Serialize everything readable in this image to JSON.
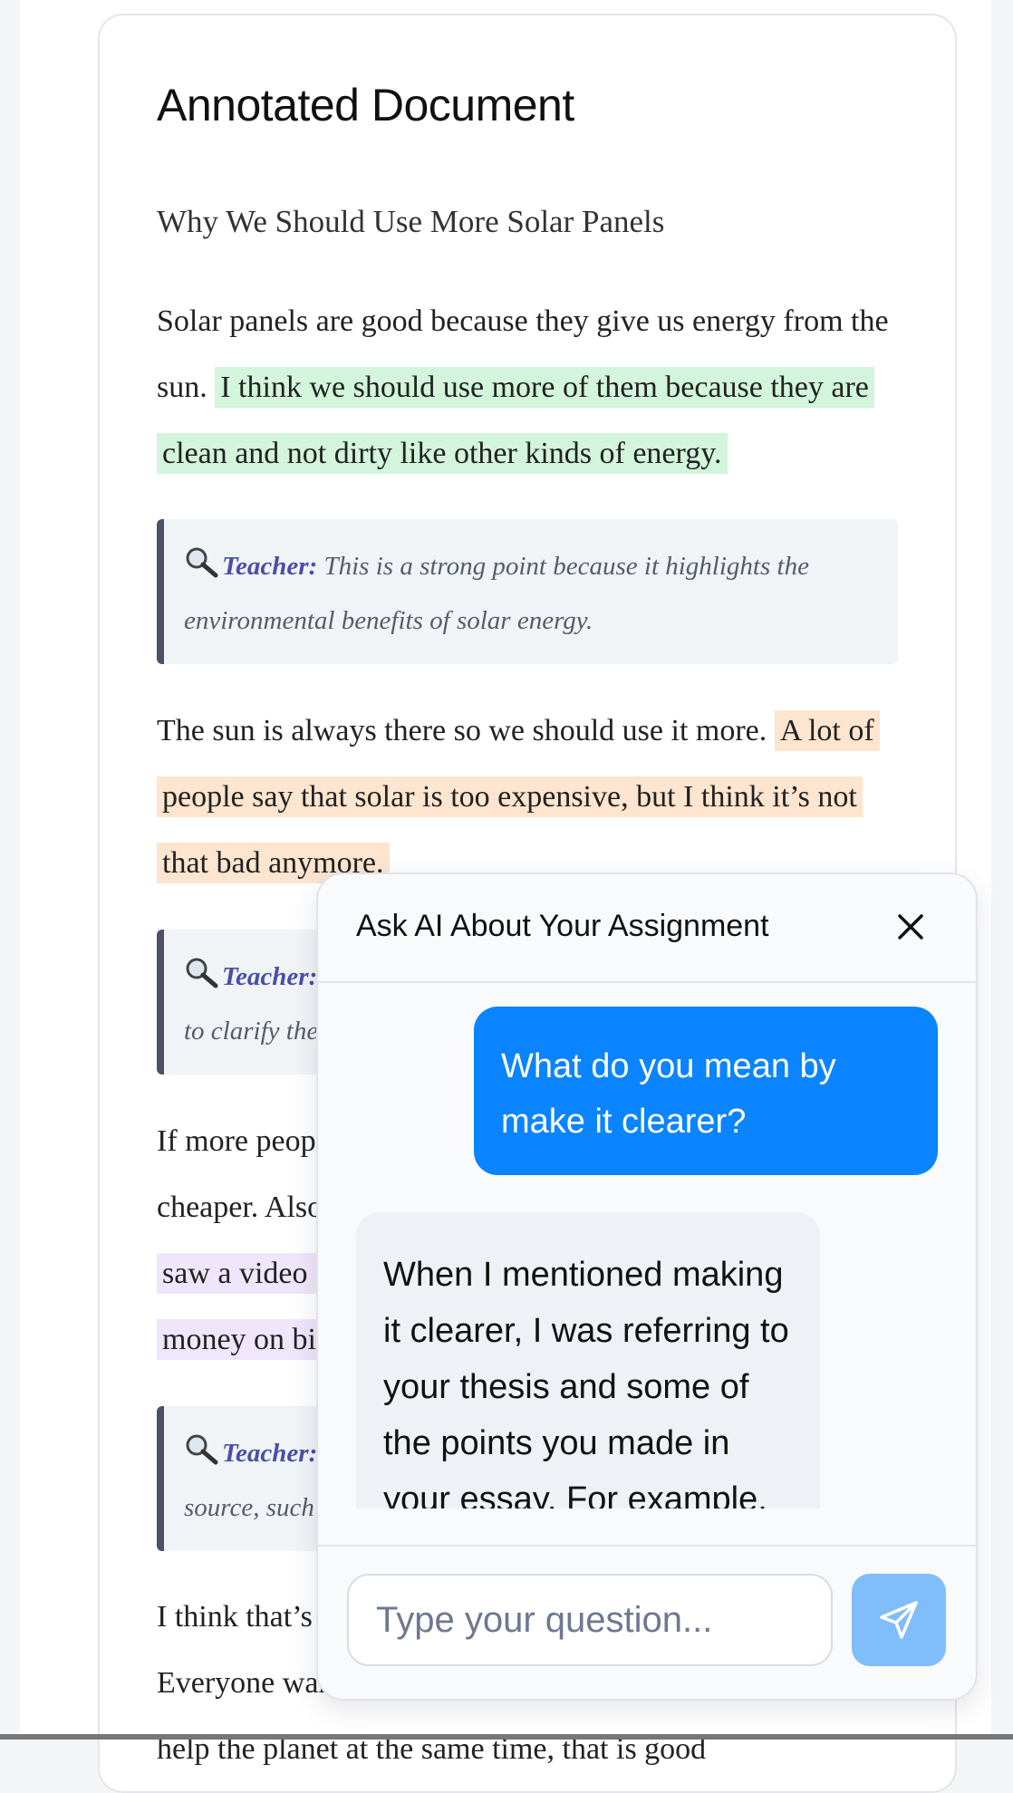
{
  "document": {
    "heading": "Annotated Document",
    "essay_title": "Why We Should Use More Solar Panels",
    "para1": {
      "plain": "Solar panels are good because they give us energy from the sun. ",
      "highlight": "I think we should use more of them because they are clean and not dirty like other kinds of energy."
    },
    "note1": {
      "label": "Teacher:",
      "text": " This is a strong point because it highlights the environmental benefits of solar energy."
    },
    "para2": {
      "plain": "The sun is always there so we should use it more. ",
      "highlight": "A lot of people say that solar is too expensive, but I think it’s not that bad anymore."
    },
    "note2": {
      "label": "Teacher:",
      "text": " to clarify the"
    },
    "para3": {
      "line1": "If more peopl",
      "line2": "cheaper. Also",
      "line3": "saw a video o",
      "line4": "money on bill"
    },
    "note3": {
      "label": "Teacher:",
      "text": " source, such"
    },
    "para4": {
      "line1": "I think that’s",
      "line2": "Everyone war",
      "line3": "help the planet at the same time, that is good"
    }
  },
  "chat": {
    "title": "Ask AI About Your Assignment",
    "user_message": "What do you mean by make it clearer?",
    "ai_message": "When I mentioned making it clearer, I was referring to your thesis and some of the points you made in your essay. For example, in the",
    "input_placeholder": "Type your question...",
    "send_color": "#80bdfb",
    "user_bubble_color": "#0a84ff"
  },
  "icons": {
    "note": "magnifying-glass-icon",
    "close": "close-icon",
    "send": "send-icon"
  }
}
